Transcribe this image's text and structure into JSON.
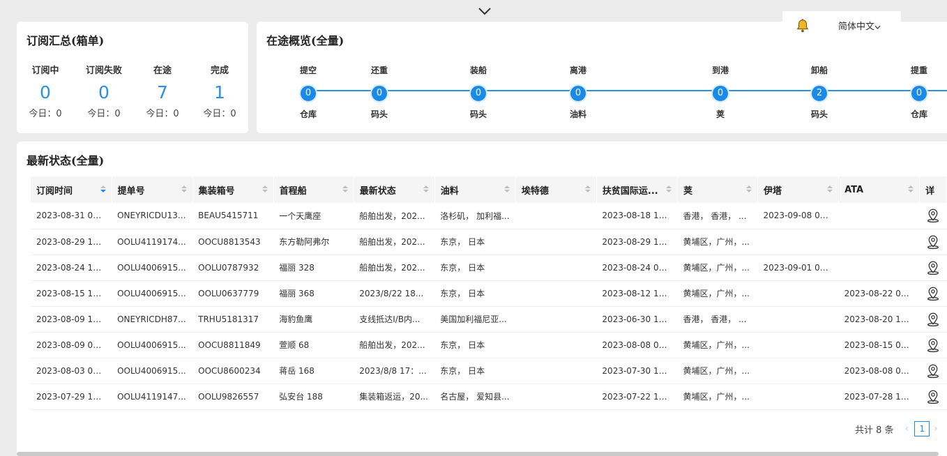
{
  "summary": {
    "title": "订阅汇总(箱单)",
    "items": [
      {
        "label": "订阅中",
        "value": "0",
        "today": "今日：0"
      },
      {
        "label": "订阅失败",
        "value": "0",
        "today": "今日：0"
      },
      {
        "label": "在途",
        "value": "7",
        "today": "今日：0"
      },
      {
        "label": "完成",
        "value": "1",
        "today": "今日：0"
      }
    ]
  },
  "transit": {
    "title": "在途概览(全量)",
    "nodes": [
      {
        "top": "提空",
        "count": "0",
        "bottom": "仓库"
      },
      {
        "top": "还重",
        "count": "0",
        "bottom": "码头"
      },
      {
        "top": "装船",
        "count": "0",
        "bottom": "码头"
      },
      {
        "top": "离港",
        "count": "0",
        "bottom": "油料"
      },
      {
        "top": "到港",
        "count": "0",
        "bottom": "荚"
      },
      {
        "top": "卸船",
        "count": "2",
        "bottom": "码头"
      },
      {
        "top": "提重",
        "count": "0",
        "bottom": "仓库"
      }
    ]
  },
  "topbar": {
    "bell_icon": "bell-icon",
    "language": "简体中文"
  },
  "status": {
    "title": "最新状态(全量)",
    "columns": [
      "订阅时间",
      "提单号",
      "集装箱号",
      "首程船",
      "最新状态",
      "油料",
      "埃特德",
      "扶贫国际运...",
      "荚",
      "伊塔",
      "ATA",
      "详"
    ],
    "rows": [
      [
        "2023-08-31 08:...",
        "ONEYRICDU13...",
        "BEAU5415711",
        "一个天鹰座",
        "船舶出发，202...",
        "洛杉矶， 加利福...",
        "",
        "2023-08-18 19:...",
        "香港， 香港， ...",
        "2023-09-08 05:...",
        ""
      ],
      [
        "2023-08-29 17:...",
        "OOLU4119174...",
        "OOCU8813543",
        "东方勒阿弗尔",
        "船舶出发，202...",
        "东京， 日本",
        "",
        "2023-08-29 15:...",
        "黄埔区，广州，...",
        "",
        ""
      ],
      [
        "2023-08-24 10:...",
        "OOLU4006915...",
        "OOLU0787932",
        "福丽 328",
        "船舶出发，202...",
        "东京， 日本",
        "",
        "2023-08-24 05:...",
        "黄埔区，广州，...",
        "2023-09-01 00:...",
        ""
      ],
      [
        "2023-08-15 15:...",
        "OOLU4006915...",
        "OOLU0637779",
        "福丽 368",
        "2023/8/22 18...",
        "东京， 日本",
        "",
        "2023-08-12 15:...",
        "黄埔区，广州，...",
        "",
        "2023-08-22 02:..."
      ],
      [
        "2023-08-09 13:...",
        "ONEYRICDH87...",
        "TRHU5181317",
        "海豹鱼鹰",
        "支线抵达I/B内...",
        "美国加利福尼亚...",
        "",
        "2023-06-30 19:...",
        "香港， 香港， ...",
        "",
        "2023-08-20 18:..."
      ],
      [
        "2023-08-09 09:...",
        "OOLU4006915...",
        "OOCU8811849",
        "萱顺 68",
        "船舶出发，202...",
        "东京， 日本",
        "",
        "2023-08-08 01:...",
        "黄埔区，广州，...",
        "",
        "2023-08-15 08:..."
      ],
      [
        "2023-08-03 09:...",
        "OOLU4006915...",
        "OOCU8600234",
        "蒋岳 168",
        "2023/8/8 17：...",
        "东京， 日本",
        "",
        "2023-07-30 15:...",
        "黄埔区，广州，...",
        "",
        "2023-08-08 03:..."
      ],
      [
        "2023-07-29 11:...",
        "OOLU4119147...",
        "OOLU9826557",
        "弘安台 188",
        "集装箱返运，20...",
        "名古屋， 爱知县...",
        "",
        "2023-07-22 15:...",
        "黄埔区，广州，...",
        "",
        "2023-07-28 16:..."
      ]
    ],
    "detail_icon": "location-pin-icon",
    "pagination": {
      "total": "共计 8 条",
      "current": "1"
    }
  },
  "colors": {
    "accent": "#1a8ae8",
    "value_blue": "#2b8fe0",
    "background": "#ececec"
  }
}
